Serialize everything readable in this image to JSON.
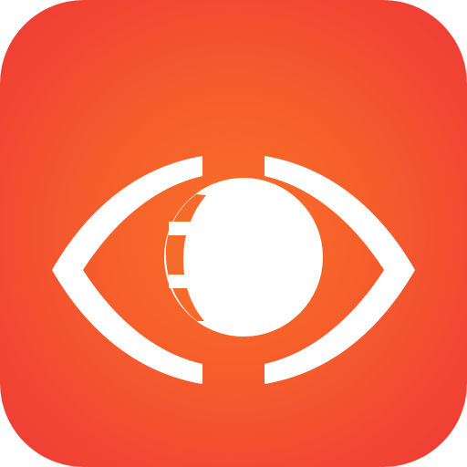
{
  "app_icon": {
    "name": "eye-app-icon",
    "icon": "eye-icon",
    "colors": {
      "background_center": "#f97028",
      "background_edge": "#ef3a36",
      "glyph": "#ffffff"
    }
  }
}
